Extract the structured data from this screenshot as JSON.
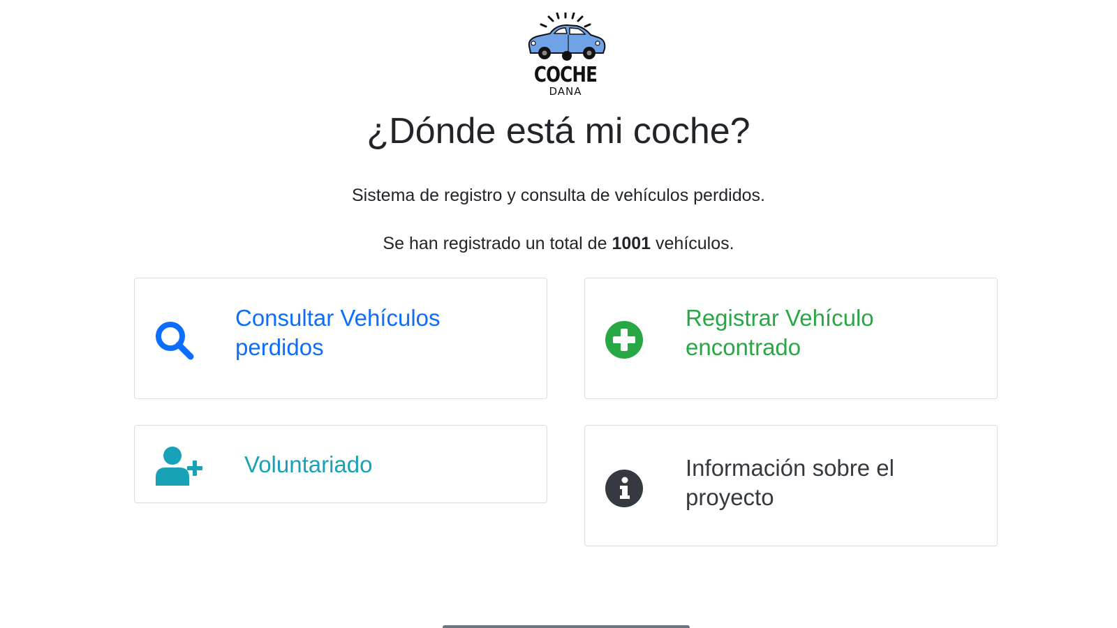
{
  "logo": {
    "name": "COCHE",
    "sub": "DANA"
  },
  "header": {
    "title": "¿Dónde está mi coche?",
    "subtitle": "Sistema de registro y consulta de vehículos perdidos.",
    "count_prefix": "Se han registrado un total de",
    "count_value": "1001",
    "count_suffix": "vehículos."
  },
  "cards": {
    "consultar": {
      "label": "Consultar Vehículos perdidos",
      "icon": "search-icon",
      "color": "#0d6efd"
    },
    "registrar": {
      "label": "Registrar Vehículo encontrado",
      "icon": "plus-circle-icon",
      "color": "#28a745"
    },
    "voluntariado": {
      "label": "Voluntariado",
      "icon": "user-plus-icon",
      "color": "#17a2b8"
    },
    "info": {
      "label": "Información sobre el proyecto",
      "icon": "info-circle-icon",
      "color": "#343a40"
    }
  },
  "colors": {
    "car_body": "#6fa3e6",
    "text": "#212529",
    "card_border": "#dcdcdc"
  }
}
